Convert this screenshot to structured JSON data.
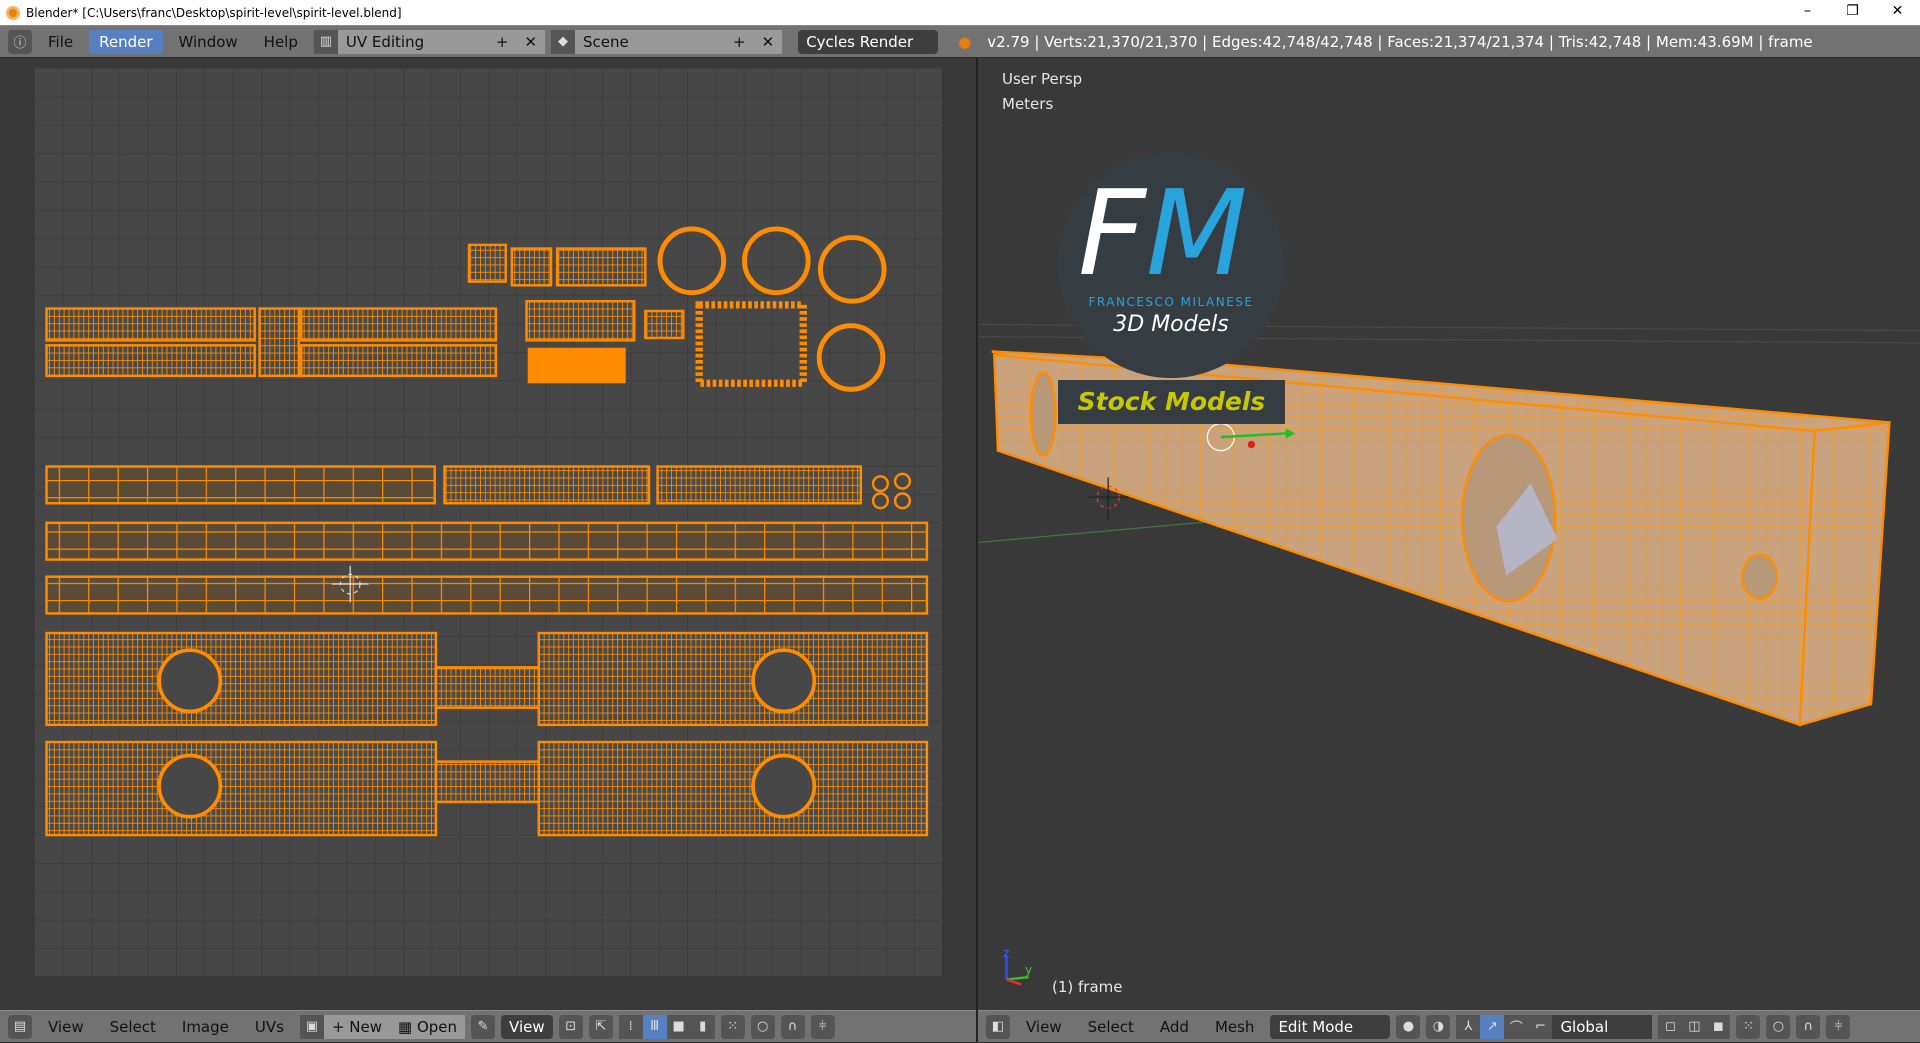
{
  "window": {
    "title": "Blender* [C:\\Users\\franc\\Desktop\\spirit-level\\spirit-level.blend]",
    "minimize": "–",
    "restore": "❐",
    "close": "✕"
  },
  "topbar": {
    "menus": [
      "File",
      "Render",
      "Window",
      "Help"
    ],
    "active_menu": "Render",
    "layout": "UV Editing",
    "scene": "Scene",
    "engine": "Cycles Render",
    "stats": "v2.79 | Verts:21,370/21,370 | Edges:42,748/42,748 | Faces:21,374/21,374 | Tris:42,748 | Mem:43.69M | frame"
  },
  "viewport": {
    "view_name": "User Persp",
    "units": "Meters",
    "frame_label": "(1) frame",
    "axis_z": "z",
    "axis_y": "y"
  },
  "watermark": {
    "initials_f": "F",
    "initials_m": "M",
    "name": "FRANCESCO MILANESE",
    "tagline": "3D Models",
    "banner": "Stock Models"
  },
  "uv_header": {
    "menus": [
      "View",
      "Select",
      "Image",
      "UVs"
    ],
    "new_label": "New",
    "open_label": "Open",
    "view_label": "View"
  },
  "view3d_header": {
    "menus": [
      "View",
      "Select",
      "Add",
      "Mesh"
    ],
    "mode": "Edit Mode",
    "orientation": "Global"
  },
  "colors": {
    "accent": "#5680c2",
    "uv_orange": "#ff8c00",
    "logo_blue": "#29a3dc",
    "banner_yellow": "#c8c800"
  }
}
